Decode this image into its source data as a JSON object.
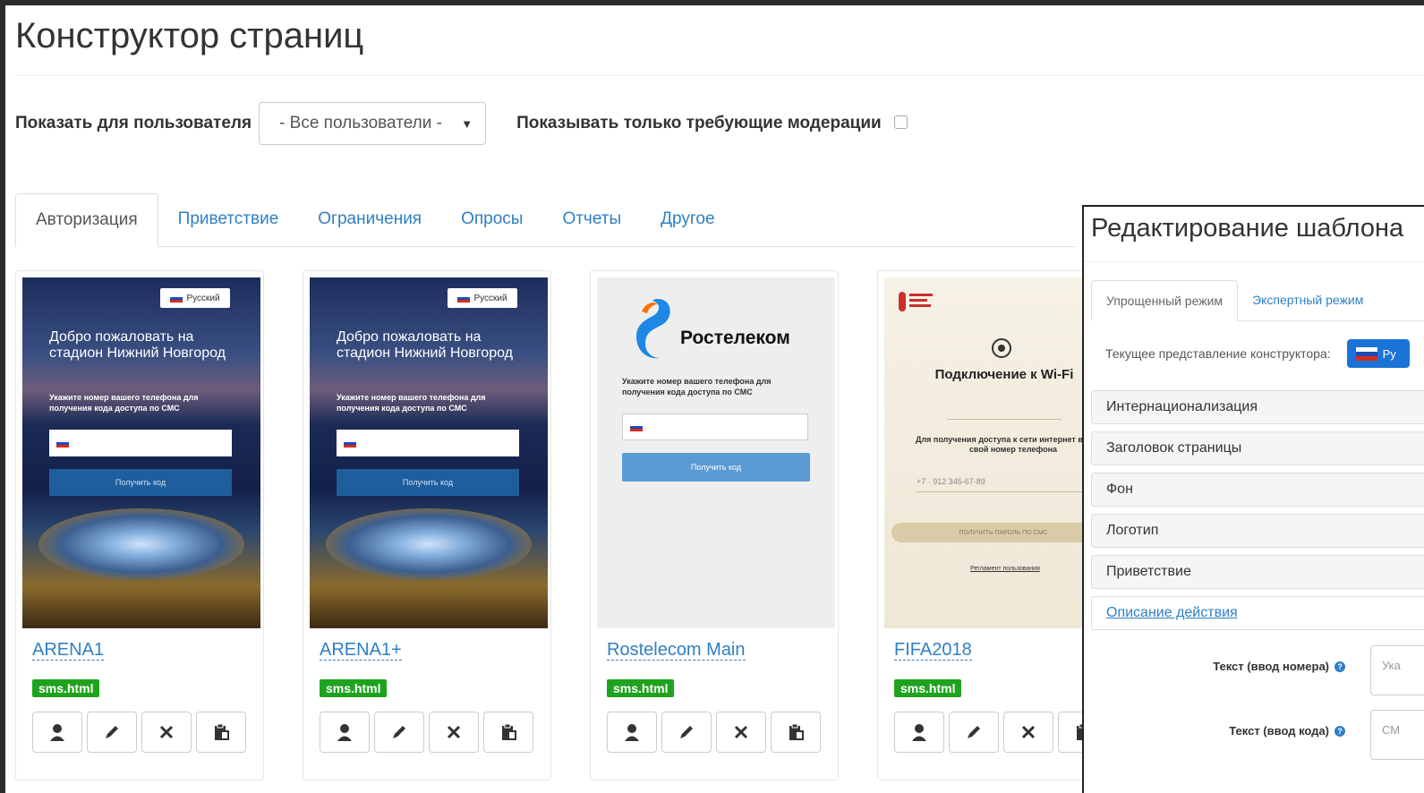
{
  "page": {
    "title": "Конструктор страниц"
  },
  "filters": {
    "user_label": "Показать для пользователя",
    "user_select_value": "- Все пользователи -",
    "moderation_label": "Показывать только требующие модерации",
    "moderation_checked": false
  },
  "tabs": [
    {
      "label": "Авторизация",
      "active": true
    },
    {
      "label": "Приветствие",
      "active": false
    },
    {
      "label": "Ограничения",
      "active": false
    },
    {
      "label": "Опросы",
      "active": false
    },
    {
      "label": "Отчеты",
      "active": false
    },
    {
      "label": "Другое",
      "active": false
    }
  ],
  "cards": [
    {
      "name": "ARENA1",
      "badge": "sms.html",
      "preview": {
        "lang": "Русский",
        "welcome": "Добро пожаловать на стадион Нижний Новгород",
        "hint": "Укажите номер вашего телефона для получения кода доступа по СМС",
        "button": "Получить код"
      }
    },
    {
      "name": "ARENA1+",
      "badge": "sms.html",
      "preview": {
        "lang": "Русский",
        "welcome": "Добро пожаловать на стадион Нижний Новгород",
        "hint": "Укажите номер вашего телефона для получения кода доступа по СМС",
        "button": "Получить код"
      }
    },
    {
      "name": "Rostelecom Main",
      "badge": "sms.html",
      "preview": {
        "brand": "Ростелеком",
        "hint": "Укажите номер вашего телефона для получения кода доступа по СМС",
        "button": "Получить код"
      }
    },
    {
      "name": "FIFA2018",
      "badge": "sms.html",
      "preview": {
        "title": "Подключение к Wi-Fi",
        "hint": "Для получения доступа к сети интернет введите свой номер телефона",
        "phone_placeholder": "+7 · 912 345-67-89",
        "button": "ПОЛУЧИТЬ ПАРОЛЬ ПО СМС",
        "rules": "Регламент пользования"
      }
    }
  ],
  "card_actions": [
    {
      "icon": "user-icon"
    },
    {
      "icon": "pencil-icon"
    },
    {
      "icon": "close-icon"
    },
    {
      "icon": "clipboard-icon"
    }
  ],
  "editor": {
    "title": "Редактирование шаблона",
    "tabs": [
      {
        "label": "Упрощенный режим",
        "active": true
      },
      {
        "label": "Экспертный режим",
        "active": false
      }
    ],
    "current_view_label": "Текущее представление конструктора:",
    "current_lang": "Ру",
    "sections": [
      {
        "label": "Интернационализация"
      },
      {
        "label": "Заголовок страницы"
      },
      {
        "label": "Фон"
      },
      {
        "label": "Логотип"
      },
      {
        "label": "Приветствие"
      },
      {
        "label": "Описание действия",
        "open": true
      }
    ],
    "fields": [
      {
        "label": "Текст (ввод номера)",
        "value": "Ука"
      },
      {
        "label": "Текст (ввод кода)",
        "value": "СМ"
      }
    ]
  },
  "colors": {
    "link": "#2f7fc5",
    "badge": "#1fa31f",
    "lang_button": "#1a73d6"
  }
}
